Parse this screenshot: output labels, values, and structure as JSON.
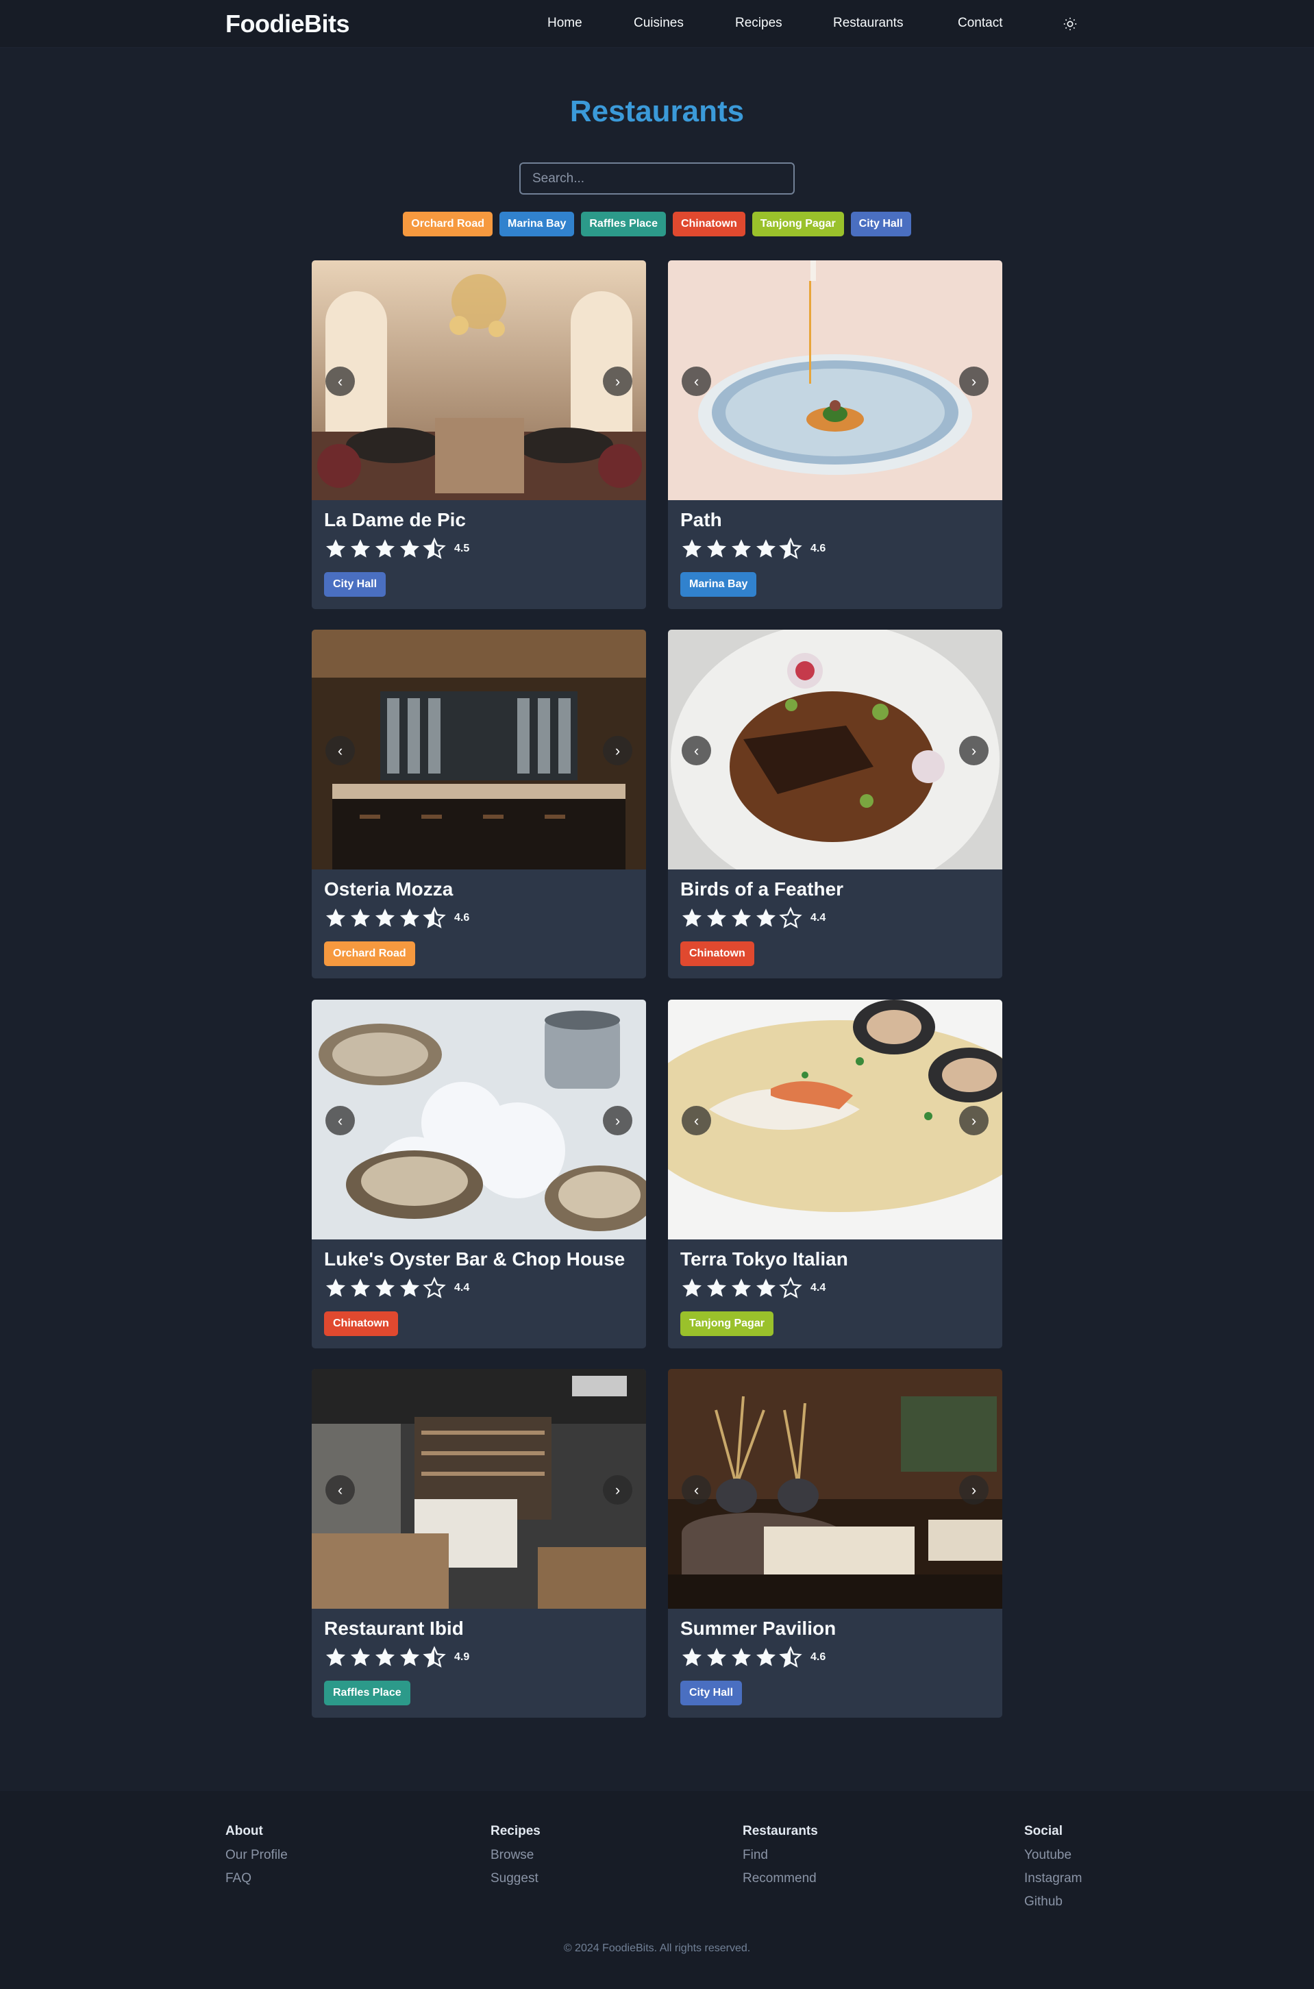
{
  "brand": "FoodieBits",
  "nav": [
    "Home",
    "Cuisines",
    "Recipes",
    "Restaurants",
    "Contact"
  ],
  "theme_icon": "sun-icon",
  "title": "Restaurants",
  "search_placeholder": "Search...",
  "colors": {
    "Orchard Road": "#f6993f",
    "Marina Bay": "#3182ce",
    "Raffles Place": "#2c9a8a",
    "Chinatown": "#e0492f",
    "Tanjong Pagar": "#9ac12b",
    "City Hall": "#4a6fc1",
    "title": "#3b9ad9"
  },
  "filters": [
    "Orchard Road",
    "Marina Bay",
    "Raffles Place",
    "Chinatown",
    "Tanjong Pagar",
    "City Hall"
  ],
  "restaurants": [
    {
      "name": "La Dame de Pic",
      "rating": "4.5",
      "tag": "City Hall",
      "image": "ornate-dining-room"
    },
    {
      "name": "Path",
      "rating": "4.6",
      "tag": "Marina Bay",
      "image": "plated-dish"
    },
    {
      "name": "Osteria Mozza",
      "rating": "4.6",
      "tag": "Orchard Road",
      "image": "bar-interior"
    },
    {
      "name": "Birds of a Feather",
      "rating": "4.4",
      "tag": "Chinatown",
      "image": "meat-dish"
    },
    {
      "name": "Luke's Oyster Bar & Chop House",
      "rating": "4.4",
      "tag": "Chinatown",
      "image": "oysters-on-ice"
    },
    {
      "name": "Terra Tokyo Italian",
      "rating": "4.4",
      "tag": "Tanjong Pagar",
      "image": "fish-dish"
    },
    {
      "name": "Restaurant Ibid",
      "rating": "4.9",
      "tag": "Raffles Place",
      "image": "open-kitchen"
    },
    {
      "name": "Summer Pavilion",
      "rating": "4.6",
      "tag": "City Hall",
      "image": "elegant-dining-room"
    }
  ],
  "footer": {
    "columns": [
      {
        "title": "About",
        "links": [
          "Our Profile",
          "FAQ"
        ]
      },
      {
        "title": "Recipes",
        "links": [
          "Browse",
          "Suggest"
        ]
      },
      {
        "title": "Restaurants",
        "links": [
          "Find",
          "Recommend"
        ]
      },
      {
        "title": "Social",
        "links": [
          "Youtube",
          "Instagram",
          "Github"
        ]
      }
    ],
    "copyright": "© 2024 FoodieBits. All rights reserved."
  }
}
